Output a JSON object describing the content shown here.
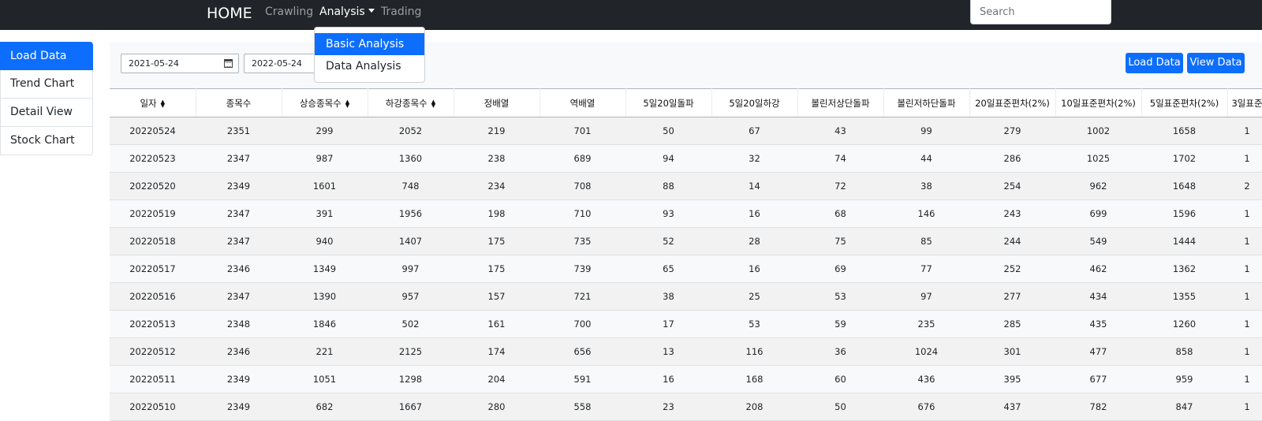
{
  "navbar": {
    "brand": "HOME",
    "links": [
      "Crawling",
      "Analysis",
      "Trading"
    ],
    "search_placeholder": "Search"
  },
  "dropdown": {
    "items": [
      "Basic Analysis",
      "Data Analysis"
    ],
    "active_index": 0
  },
  "sidebar": {
    "items": [
      "Load Data",
      "Trend Chart",
      "Detail View",
      "Stock Chart"
    ],
    "active_index": 0
  },
  "controls": {
    "start_date": "2021-05-24",
    "end_date": "2022-05-24",
    "load_button": "Load Data",
    "view_button": "View Data"
  },
  "table": {
    "headers": [
      "일자",
      "종목수",
      "상승종목수",
      "하강종목수",
      "정배열",
      "역배열",
      "5일20일돌파",
      "5일20일하강",
      "볼린저상단돌파",
      "볼린저하단돌파",
      "20일표준편차(2%)",
      "10일표준편차(2%)",
      "5일표준편차(2%)",
      "3일표준"
    ],
    "sortable": [
      true,
      false,
      true,
      true,
      false,
      false,
      false,
      false,
      false,
      false,
      false,
      false,
      false,
      false
    ],
    "rows": [
      [
        "20220524",
        "2351",
        "299",
        "2052",
        "219",
        "701",
        "50",
        "67",
        "43",
        "99",
        "279",
        "1002",
        "1658",
        "1"
      ],
      [
        "20220523",
        "2347",
        "987",
        "1360",
        "238",
        "689",
        "94",
        "32",
        "74",
        "44",
        "286",
        "1025",
        "1702",
        "1"
      ],
      [
        "20220520",
        "2349",
        "1601",
        "748",
        "234",
        "708",
        "88",
        "14",
        "72",
        "38",
        "254",
        "962",
        "1648",
        "2"
      ],
      [
        "20220519",
        "2347",
        "391",
        "1956",
        "198",
        "710",
        "93",
        "16",
        "68",
        "146",
        "243",
        "699",
        "1596",
        "1"
      ],
      [
        "20220518",
        "2347",
        "940",
        "1407",
        "175",
        "735",
        "52",
        "28",
        "75",
        "85",
        "244",
        "549",
        "1444",
        "1"
      ],
      [
        "20220517",
        "2346",
        "1349",
        "997",
        "175",
        "739",
        "65",
        "16",
        "69",
        "77",
        "252",
        "462",
        "1362",
        "1"
      ],
      [
        "20220516",
        "2347",
        "1390",
        "957",
        "157",
        "721",
        "38",
        "25",
        "53",
        "97",
        "277",
        "434",
        "1355",
        "1"
      ],
      [
        "20220513",
        "2348",
        "1846",
        "502",
        "161",
        "700",
        "17",
        "53",
        "59",
        "235",
        "285",
        "435",
        "1260",
        "1"
      ],
      [
        "20220512",
        "2346",
        "221",
        "2125",
        "174",
        "656",
        "13",
        "116",
        "36",
        "1024",
        "301",
        "477",
        "858",
        "1"
      ],
      [
        "20220511",
        "2349",
        "1051",
        "1298",
        "204",
        "591",
        "16",
        "168",
        "60",
        "436",
        "395",
        "677",
        "959",
        "1"
      ],
      [
        "20220510",
        "2349",
        "682",
        "1667",
        "280",
        "558",
        "23",
        "208",
        "50",
        "676",
        "437",
        "782",
        "847",
        "1"
      ]
    ]
  },
  "colors": {
    "navbar_bg": "#212529",
    "primary": "#0d6efd",
    "panel_bg": "#f8f9fa"
  }
}
